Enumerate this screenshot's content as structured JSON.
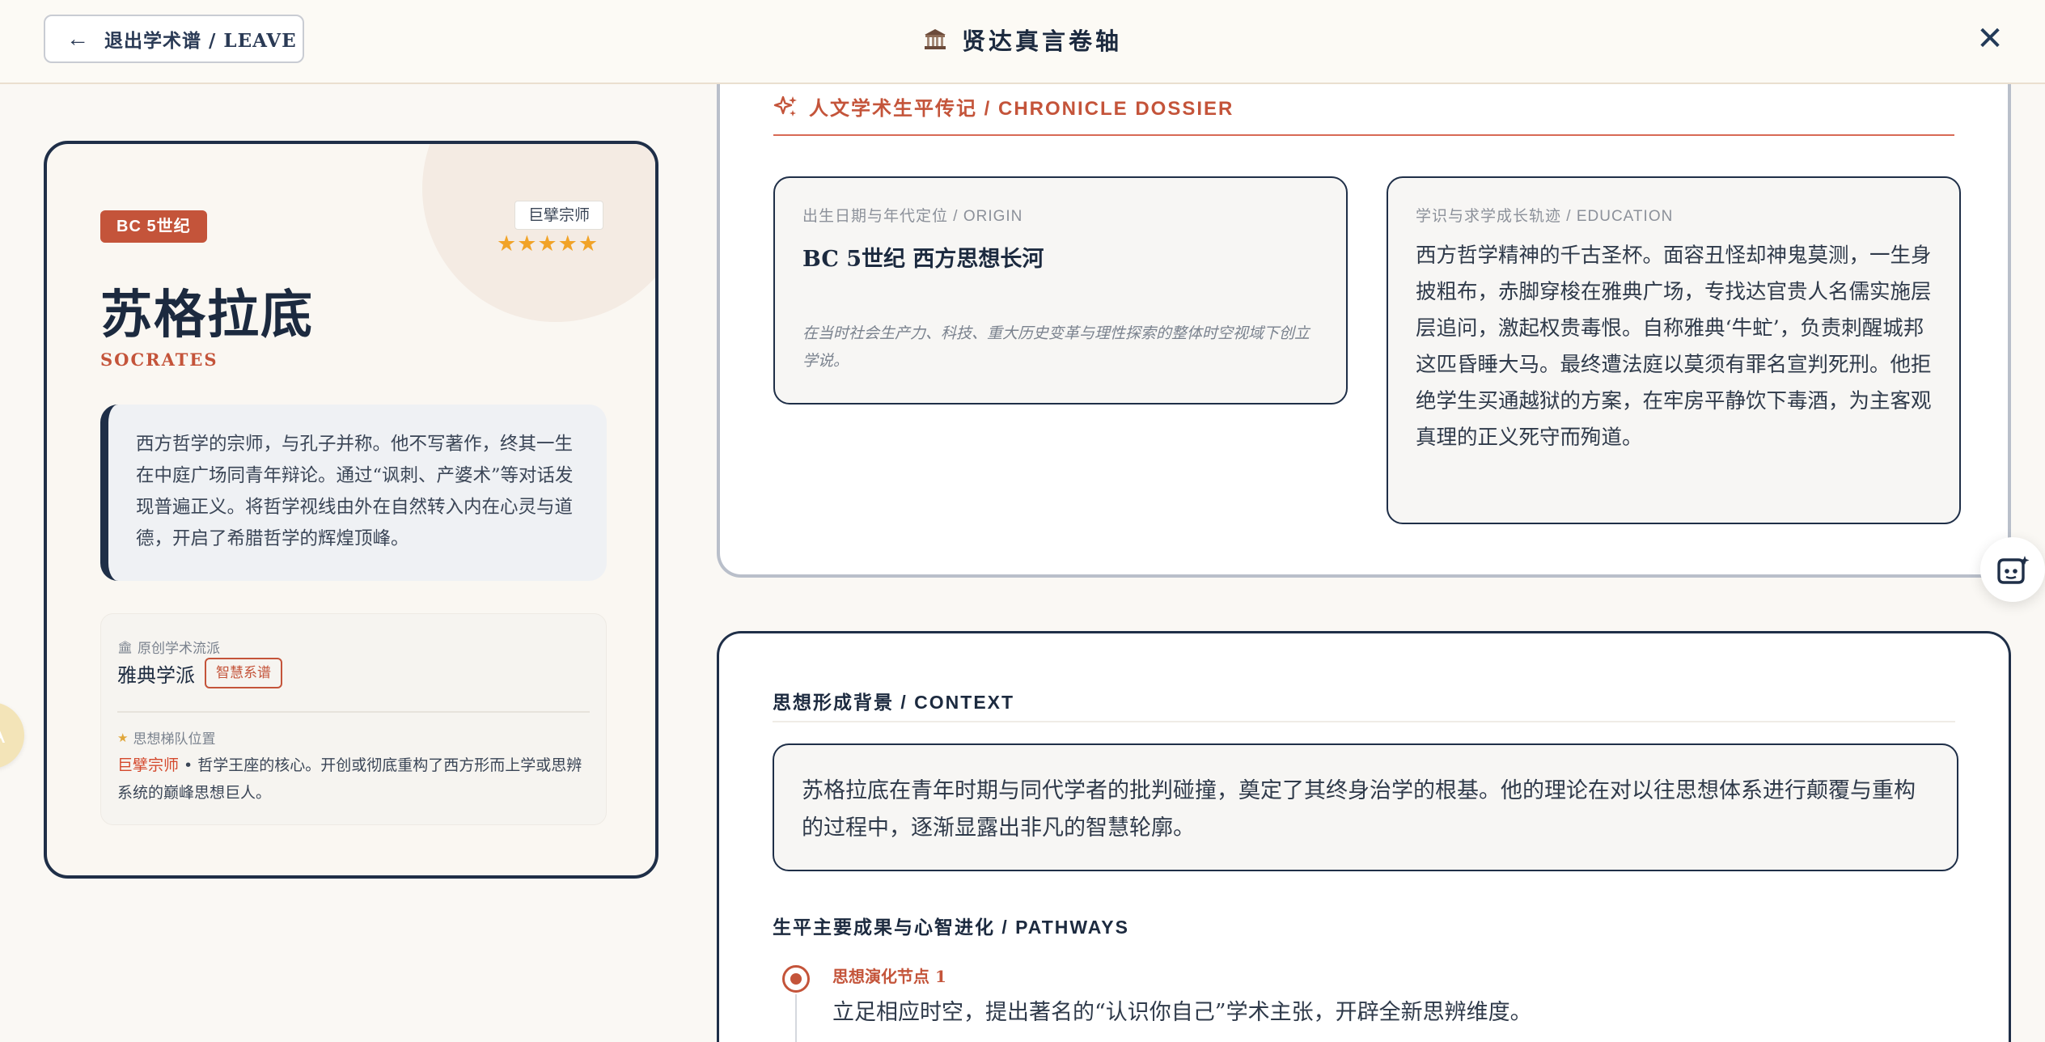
{
  "topbar": {
    "leave_label": "退出学术谱 / LEAVE",
    "title": "贤达真言卷轴",
    "title_icon": "temple-icon",
    "close_symbol": "✕"
  },
  "profile": {
    "era": "BC 5世纪",
    "rank": "巨擘宗师",
    "stars": "★★★★★",
    "rating": 5,
    "name_cn": "苏格拉底",
    "name_en": "SOCRATES",
    "summary": "西方哲学的宗师，与孔子并称。他不写著作，终其一生在中庭广场同青年辩论。通过“讽刺、产婆术”等对话发现普遍正义。将哲学视线由外在自然转入内在心灵与道德，开启了希腊哲学的辉煌顶峰。",
    "school_label": "原创学术流派",
    "school_name": "雅典学派",
    "school_badge": "智慧系谱",
    "position_label": "思想梯队位置",
    "position_highlight": "巨擘宗师",
    "position_text": " • 哲学王座的核心。开创或彻底重构了西方形而上学或思辨系统的巅峰思想巨人。",
    "edge_tab_letter": "A"
  },
  "chronicle": {
    "heading": "人文学术生平传记 / CHRONICLE DOSSIER",
    "origin": {
      "label": "出生日期与年代定位 / ORIGIN",
      "title": "BC 5世纪 西方思想长河",
      "note": "在当时社会生产力、科技、重大历史变革与理性探索的整体时空视域下创立学说。"
    },
    "education": {
      "label": "学识与求学成长轨迹 / EDUCATION",
      "text": "西方哲学精神的千古圣杯。面容丑怪却神鬼莫测，一生身披粗布，赤脚穿梭在雅典广场，专找达官贵人名儒实施层层追问，激起权贵毒恨。自称雅典‘牛虻’，负责刺醒城邦这匹昏睡大马。最终遭法庭以莫须有罪名宣判死刑。他拒绝学生买通越狱的方案，在牢房平静饮下毒酒，为主客观真理的正义死守而殉道。"
    }
  },
  "context": {
    "heading": "思想形成背景 / CONTEXT",
    "text": "苏格拉底在青年时期与同代学者的批判碰撞，奠定了其终身治学的根基。他的理论在对以往思想体系进行颠覆与重构的过程中，逐渐显露出非凡的智慧轮廓。",
    "pathways_heading": "生平主要成果与心智进化 / PATHWAYS",
    "nodes": [
      {
        "label": "思想演化节点 1",
        "text": "立足相应时空，提出著名的“认识你自己”学术主张，开辟全新思辨维度。"
      }
    ]
  },
  "colors": {
    "accent": "#c4543a",
    "navy": "#1f2f48",
    "star": "#f1a328",
    "background": "#faf8f4"
  }
}
